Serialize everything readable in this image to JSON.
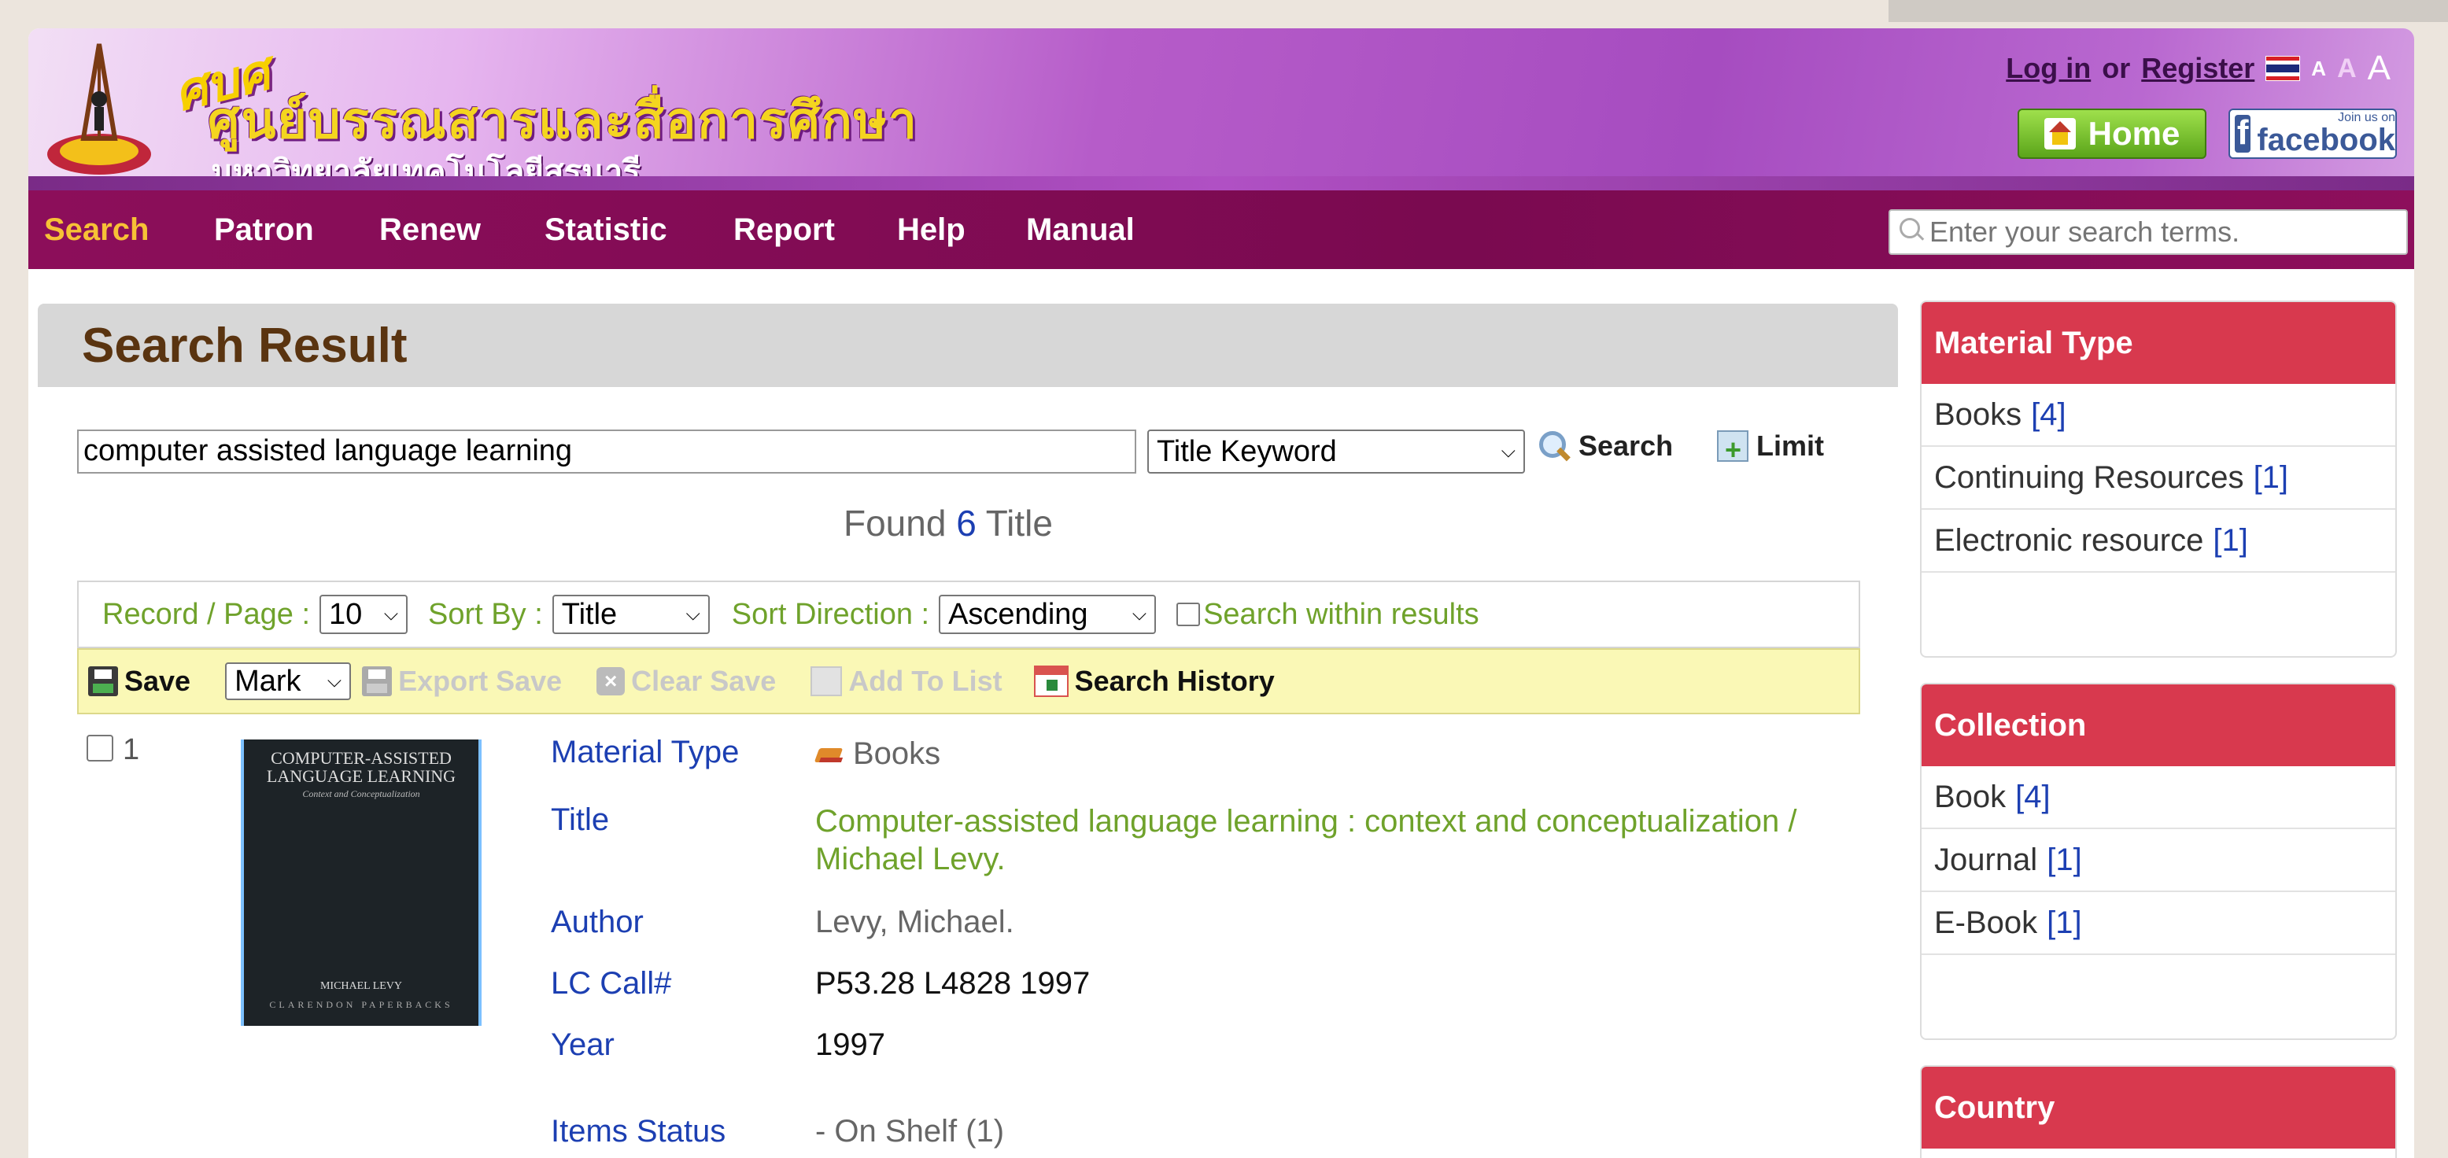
{
  "header": {
    "badge": "ศบศ",
    "org_name_th": "ศูนย์บรรณสารและสื่อการศึกษา",
    "university_th": "มหาวิทยาลัยเทคโนโลยีสุรนารี",
    "login_label": "Log in",
    "or_label": "or",
    "register_label": "Register",
    "font_size_labels": [
      "A",
      "A",
      "A"
    ],
    "home_label": "Home",
    "facebook_join": "Join us on",
    "facebook_label": "facebook"
  },
  "nav": {
    "items": [
      "Search",
      "Patron",
      "Renew",
      "Statistic",
      "Report",
      "Help",
      "Manual"
    ],
    "active": "Search",
    "search_placeholder": "Enter your search terms."
  },
  "main": {
    "title": "Search Result",
    "query": "computer assisted language learning",
    "search_field": "Title Keyword",
    "search_button": "Search",
    "limit_button": "Limit",
    "found_prefix": "Found",
    "found_count": "6",
    "found_suffix": "Title",
    "options": {
      "record_label": "Record / Page :",
      "record_value": "10",
      "sort_label": "Sort By :",
      "sort_value": "Title",
      "direction_label": "Sort Direction :",
      "direction_value": "Ascending",
      "within_label": "Search within results"
    },
    "toolbar": {
      "save": "Save",
      "mark": "Mark",
      "export_save": "Export Save",
      "clear_save": "Clear Save",
      "add_to_list": "Add To List",
      "search_history": "Search History"
    },
    "record": {
      "number": "1",
      "cover": {
        "title": "COMPUTER-ASSISTED LANGUAGE LEARNING",
        "subtitle": "Context and Conceptualization",
        "author": "MICHAEL LEVY",
        "publisher": "CLARENDON PAPERBACKS"
      },
      "labels": {
        "material_type": "Material Type",
        "title": "Title",
        "author": "Author",
        "call": "LC Call#",
        "year": "Year",
        "status": "Items Status"
      },
      "values": {
        "material_type": "Books",
        "title": "Computer-assisted language learning : context and conceptualization / Michael Levy.",
        "author": "Levy, Michael.",
        "call": "P53.28 L4828 1997",
        "year": "1997",
        "status": "- On Shelf (1)"
      }
    }
  },
  "sidebar": {
    "material_type": {
      "title": "Material Type",
      "items": [
        {
          "label": "Books",
          "count": "[4]"
        },
        {
          "label": "Continuing Resources",
          "count": "[1]"
        },
        {
          "label": "Electronic resource",
          "count": "[1]"
        }
      ]
    },
    "collection": {
      "title": "Collection",
      "items": [
        {
          "label": "Book",
          "count": "[4]"
        },
        {
          "label": "Journal",
          "count": "[1]"
        },
        {
          "label": "E-Book",
          "count": "[1]"
        }
      ]
    },
    "country": {
      "title": "Country"
    }
  },
  "colors": {
    "nav_bg": "#7a0a50",
    "active_nav": "#f7c136",
    "panel_header": "#d8394e",
    "link_blue": "#1c3fb2",
    "green_text": "#6fa22b"
  }
}
